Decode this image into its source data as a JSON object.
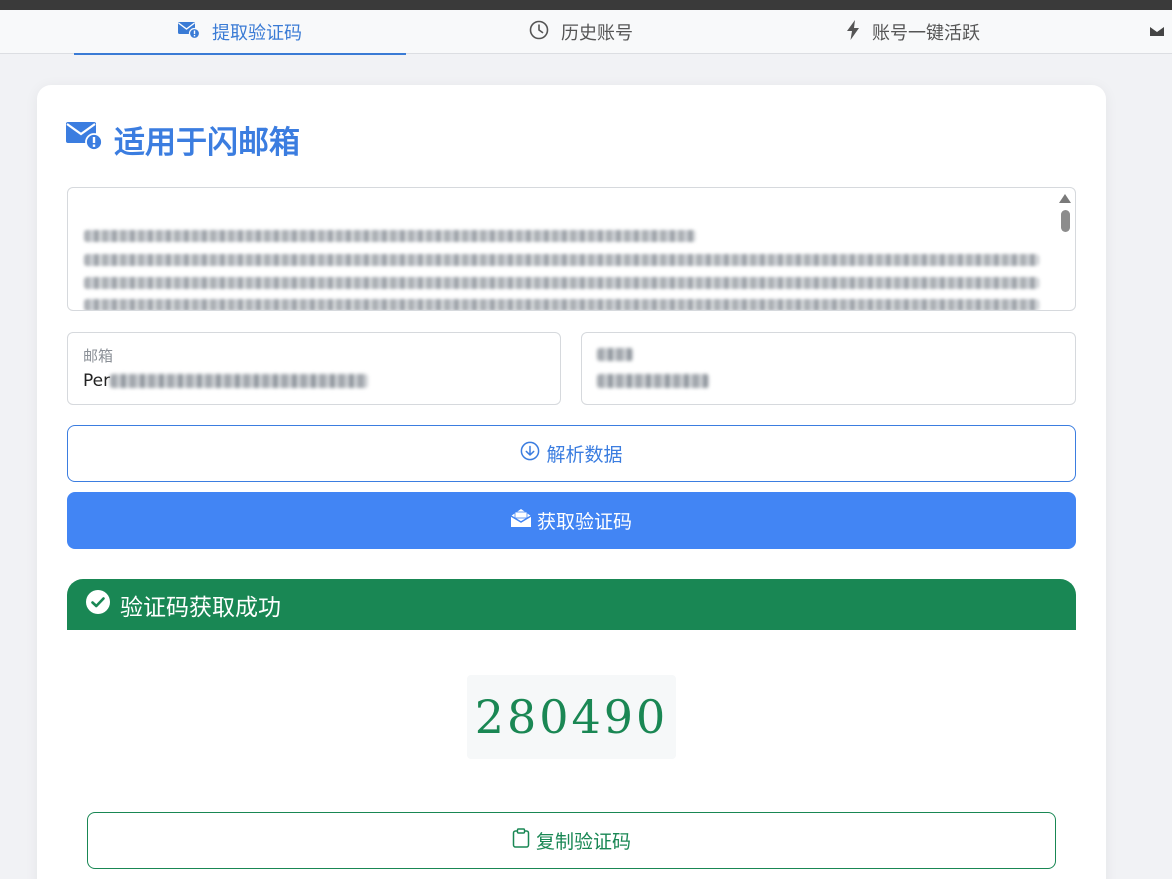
{
  "tabs": [
    {
      "label": "提取验证码",
      "icon": "envelope-alert-icon",
      "active": true
    },
    {
      "label": "历史账号",
      "icon": "clock-icon",
      "active": false
    },
    {
      "label": "账号一键活跃",
      "icon": "bolt-icon",
      "active": false
    }
  ],
  "card": {
    "title": "适用于闪邮箱",
    "title_icon": "envelope-alert-icon"
  },
  "email_field": {
    "label": "邮箱",
    "value_prefix": "Per"
  },
  "buttons": {
    "parse": "解析数据",
    "get_code": "获取验证码",
    "copy": "复制验证码"
  },
  "result": {
    "header": "验证码获取成功",
    "code": "280490"
  },
  "colors": {
    "accent": "#3b7de0",
    "primary_button": "#4285f4",
    "success": "#198754"
  }
}
